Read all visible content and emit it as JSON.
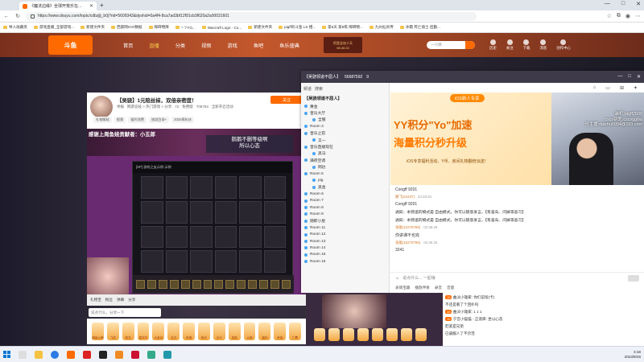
{
  "browser": {
    "tab_title": "《魔法边缘》全球开荒乐在...",
    "url": "https://www.douyu.com/topic/cdbzjlj_b0j?rid=5609343&dyshid=0a4f4-8ca7ad3bf12f91cb3f620a2a00031601",
    "bookmarks": [
      "导入收藏夹",
      "游戏直播_全部游戏...",
      "新建文件夹",
      "西部网IGO数据",
      "障碍物库",
      "\"- \\\"YO...",
      "Warcraft Logo - Co...",
      "新建文件夹",
      "pigff的斗鱼 LS 相...",
      "第6天 第8练 障碍物...",
      "九州仙剑传",
      "冰霜 死亡骑士 后勤..."
    ]
  },
  "douyu": {
    "logo": "斗鱼",
    "nav": [
      "首页",
      "直播",
      "分类",
      "视频",
      "游戏",
      "鱼吧",
      "鱼乐盛典"
    ],
    "active_nav": "直播",
    "promo_line1": "阿里全站十天",
    "promo_line2": "08:40:23",
    "search_placeholder": "一只豚",
    "header_icons": [
      "历史",
      "关注",
      "下载",
      "消息",
      "创作中心"
    ]
  },
  "room": {
    "title": "【吴骁】1元陪丝袜，双倍亲密度！",
    "sub": [
      "举报",
      "网游竞技 > 热门游戏 > 分享"
    ],
    "stats": [
      "72",
      "免费版",
      "706753",
      "全新开启活动"
    ],
    "tags": [
      "礼物踢狱",
      "视频",
      "福利消费",
      "旅游目录+",
      "2020周年庆"
    ],
    "follow": "关注",
    "banner_left": "感谢上周鱼娃贡献者：小五郎",
    "banner_right_1": "鹅鹅不删等级啊",
    "banner_right_2": "所以心态",
    "game_title": "[SP] 游戏之友示例 示例",
    "live_bar": [
      "礼物宝",
      "粉丝",
      "弹幕",
      "分享"
    ],
    "chat_input": "说点什么，分享一下",
    "gifts": [
      "超级火箭",
      "飞机",
      "鲜花",
      "嘉年华",
      "大宝剑",
      "告白",
      "玫瑰",
      "粉丝",
      "办卡",
      "奖励",
      "火箭",
      "福利",
      "贵族",
      "门票"
    ]
  },
  "yy": {
    "title": "【吴骁领道不屈人】",
    "id": "56687592",
    "online": "9",
    "left_top": [
      "频道",
      "搜索"
    ],
    "channel": "【吴骁领道不屈人】",
    "tree": [
      {
        "label": "黄金",
        "sub": false
      },
      {
        "label": "音乐大厅",
        "sub": false
      },
      {
        "label": "全服",
        "sub": true
      },
      {
        "label": "Room 3",
        "sub": false
      },
      {
        "label": "音乐之前",
        "sub": false
      },
      {
        "label": "又一",
        "sub": true
      },
      {
        "label": "音乐直播现在",
        "sub": false
      },
      {
        "label": "黑马",
        "sub": true
      },
      {
        "label": "满荷空调",
        "sub": false
      },
      {
        "label": "网达",
        "sub": true
      },
      {
        "label": "Room 5",
        "sub": false
      },
      {
        "label": "pig",
        "sub": true
      },
      {
        "label": "黑金",
        "sub": true
      },
      {
        "label": "Room 6",
        "sub": false
      },
      {
        "label": "Room 7",
        "sub": false
      },
      {
        "label": "Room 8",
        "sub": false
      },
      {
        "label": "Room 9",
        "sub": false
      },
      {
        "label": "随即小屋",
        "sub": false
      },
      {
        "label": "Room 11",
        "sub": false
      },
      {
        "label": "Room 12",
        "sub": false
      },
      {
        "label": "Room 13",
        "sub": false
      },
      {
        "label": "Room 14",
        "sub": false
      },
      {
        "label": "Room 15",
        "sub": false
      },
      {
        "label": "Room 16",
        "sub": false
      }
    ],
    "banner_badge": "iOS新人专享",
    "banner_line1": "YY积分\"Yo\"加速",
    "banner_line2": "海量积分秒升级",
    "banner_line3": "iOS专享福利活动，Y币、房间礼物翻倍派送！",
    "cam_text": [
      "装机:pigff2500",
      "cscs钥匙:cscsgg6w",
      "当主播:daizhu0904@163.com"
    ],
    "chat": [
      {
        "type": "msg",
        "name": "",
        "time": "",
        "text": "Congff 9201"
      },
      {
        "type": "head",
        "name": "路飞(24437)",
        "time": "23:28:34",
        "text": ""
      },
      {
        "type": "msg",
        "name": "",
        "time": "",
        "text": "Congff 9201"
      },
      {
        "type": "sys",
        "name": "",
        "time": "",
        "text": "通知：本频道的模式是 自由模式，你可以随意发言。【有喜岛、问屏等恶习】"
      },
      {
        "type": "sys",
        "name": "",
        "time": "",
        "text": "通知：本频道的模式是 自由模式，你可以随意发言。【有喜岛、问屏等恶习】"
      },
      {
        "type": "head",
        "name": "张雄(10270785)",
        "time": "02:36:29",
        "text": ""
      },
      {
        "type": "msg",
        "name": "",
        "time": "",
        "text": "你讲课不也完"
      },
      {
        "type": "head",
        "name": "张雄(10270785)",
        "time": "02:36:32",
        "text": ""
      },
      {
        "type": "msg",
        "name": "",
        "time": "",
        "text": "3241"
      }
    ],
    "input_placeholder": "说点什么... 一起嗨",
    "bottom": [
      "表情宝藏",
      "播放伴奏",
      "录音",
      "音量"
    ]
  },
  "strip_chat": [
    {
      "badge": "15",
      "text": "曲淡小雄家: 你们说啥(卡)"
    },
    {
      "badge": "",
      "text": "不还是看了个回扑吗"
    },
    {
      "badge": "08",
      "text": "曲淡小雄家: 1 1 1"
    },
    {
      "badge": "15",
      "text": "宁宫小猫猫 - 正道库: 坐以心态"
    },
    {
      "badge": "",
      "text": "赶紧是兄弟"
    },
    {
      "badge": "",
      "text": "已逼服人了不示范"
    }
  ],
  "taskbar": {
    "time": "3:18",
    "date": "2023/9/26"
  }
}
